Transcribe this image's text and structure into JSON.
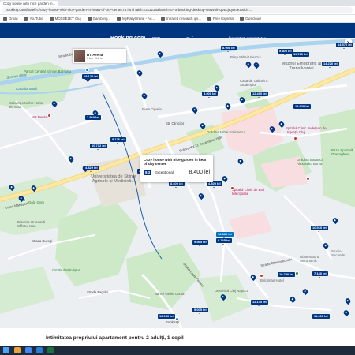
{
  "browser": {
    "tab_label": "Cozy house with nice garden in...",
    "url": "booking.com/hotel/ro/cozy-house-with-nice-garden-in-heart-of-city-center.ro.html?aid=2311236&label=ro-ro-booking-desktop-sMWhlRqpEcjKyRcK&sid=...",
    "bookmarks": [
      "Gmail",
      "YouTube",
      "MOSSELEY Cluj",
      "Gambling...",
      "MyRallyOnline - Au...",
      "Infrared research ips...",
      "Free Express",
      "Owncloud"
    ]
  },
  "booking": {
    "logo": "Booking.com",
    "currency": "RON",
    "list_property": "Înregistrați proprietatea",
    "icons": "☰ ?"
  },
  "map": {
    "close_icon": "×",
    "labels": {
      "strada_dorobantilor": "Strada Dorobanților",
      "canalul": "Canalul Morii",
      "someșul": "Someșul Mic",
      "parcul_central": "Parcul Central Simion Barnuțiu",
      "muzeul": "Muzeul Etnografic al Transilvaniei",
      "piata": "Piața Mihai Viteazul",
      "casa_cultura": "Casa de Cultură a Studenților",
      "sala": "Sala Sporturilor Horia Demian",
      "mb_dental": "MB Dental",
      "str_clinicilor": "Str. Clinicilor",
      "piata_cipariu": "Piața Cipariu",
      "gradina": "Grădina Mihai Eminescu",
      "spitalul": "Spitalul Clinic Județean de Urgență Cluj",
      "gradina_botanica": "Grădina Botanică Alexandru Borza",
      "universitatea": "Universitatea de Științe Agricole și Medicină...",
      "calea_manastur": "Calea Mănăștur",
      "bd_babes": "Bulevardul 21 Decembrie 1989",
      "gold_gym": "Gold Gym",
      "spitalul_clinic": "Spitalul Clinic de Boli Infecțioase",
      "observatorul": "Observatorul Astronomic",
      "studio": "Studio Seconds",
      "baza": "Baza Sportivă Gheorgheni",
      "str_observatorului": "Strada Observatorului",
      "beldiman": "Beldiman Hotel",
      "str_pasteur": "Strada Louis Pasteur",
      "biserica": "Biserica Ortodoxă Sfântul Ioan",
      "cimitirul": "Cimitirul Mănăștur",
      "barrel": "Barrel Vasile Conta",
      "deschisa": "Deschisă Cluj Napoca",
      "str_fagului": "Strada Fagului",
      "str_bucegi": "Strada Bucegi",
      "explorati": "Explorați"
    },
    "prices": [
      "8.998 lei",
      "9.800 lei",
      "11.780 lei",
      "14.570 lei",
      "14.220 lei",
      "19.120 lei",
      "7.560 lei",
      "4.000 lei",
      "12.400 lei",
      "12.620 lei",
      "10.712 lei",
      "8.126 lei",
      "4.329 lei",
      "12.010 lei",
      "8.600 lei",
      "4.600 lei",
      "9.745 lei",
      "10.910 lei",
      "12.360 lei",
      "9.565 lei",
      "10.700 lei",
      "7.140 lei",
      "12.140 lei",
      "5.005 lei",
      "11.600 lei",
      "10.960 lei"
    ],
    "card_small": {
      "title": "BT Arena",
      "subtitle": "1 km  ·  1-8 lei"
    },
    "card_big": {
      "title": "Cozy house with nice garden in heart of city center",
      "score": "9,3",
      "rating_word": "Excepțional",
      "price": "8.400 lei"
    }
  },
  "bottom": {
    "text": "Intimitatea propriului apartament pentru 2 adulți, 1 copil"
  }
}
